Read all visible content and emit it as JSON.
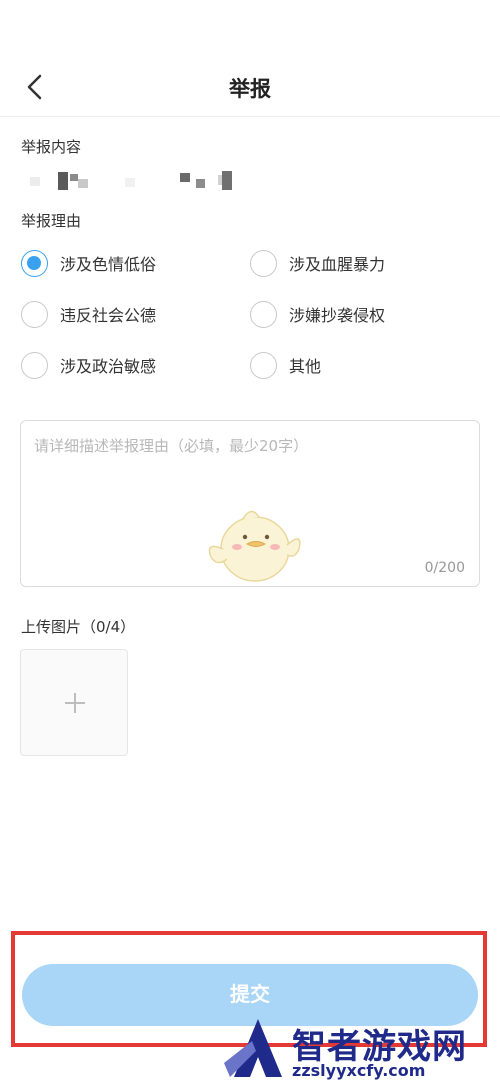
{
  "header": {
    "title": "举报",
    "back_icon": "chevron-left-icon"
  },
  "report_content": {
    "label": "举报内容"
  },
  "report_reason": {
    "label": "举报理由",
    "selected": "涉及色情低俗",
    "options": [
      {
        "label": "涉及色情低俗",
        "checked": true
      },
      {
        "label": "涉及血腥暴力",
        "checked": false
      },
      {
        "label": "违反社会公德",
        "checked": false
      },
      {
        "label": "涉嫌抄袭侵权",
        "checked": false
      },
      {
        "label": "涉及政治敏感",
        "checked": false
      },
      {
        "label": "其他",
        "checked": false
      }
    ]
  },
  "description": {
    "placeholder": "请详细描述举报理由（必填，最少20字）",
    "value": "",
    "counter": "0/200"
  },
  "upload": {
    "label": "上传图片（0/4）",
    "add_icon": "plus-icon"
  },
  "submit": {
    "label": "提交"
  },
  "watermark": {
    "title": "智者游戏网",
    "url": "zzslyyxcfy.com"
  },
  "colors": {
    "accent": "#3aa0f0",
    "submit_bg": "#a9d6f7",
    "highlight": "#e53935",
    "watermark": "#1f2a8a"
  }
}
